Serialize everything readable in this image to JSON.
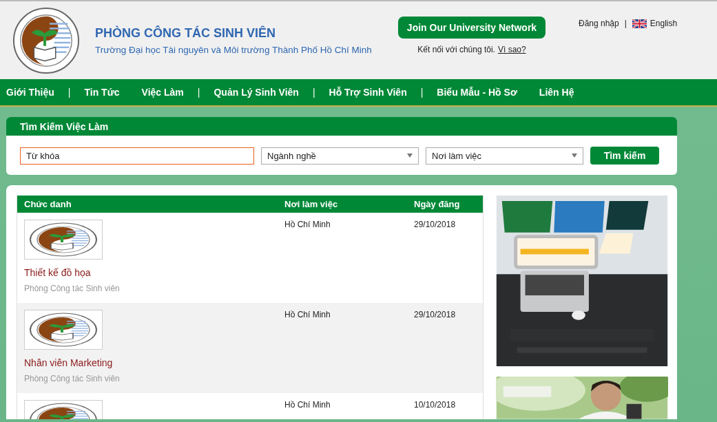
{
  "header": {
    "title": "PHÒNG CÔNG TÁC SINH VIÊN",
    "subtitle": "Trường Đại học Tài nguyên và Môi trường Thành Phố Hồ Chí Minh",
    "join_button": "Join Our University Network",
    "connect_text": "Kết nối với chúng tôi.",
    "why_link": "Vì sao?",
    "login": "Đăng nhập",
    "separator": "|",
    "language": "English"
  },
  "nav": [
    {
      "kind": "link",
      "label": "Giới Thiệu"
    },
    {
      "kind": "separator",
      "label": "|"
    },
    {
      "kind": "link",
      "label": "Tin Tức"
    },
    {
      "kind": "link",
      "label": "Việc Làm"
    },
    {
      "kind": "separator",
      "label": "|"
    },
    {
      "kind": "link",
      "label": "Quản Lý Sinh Viên"
    },
    {
      "kind": "separator",
      "label": "|"
    },
    {
      "kind": "link",
      "label": "Hỗ Trợ Sinh Viên"
    },
    {
      "kind": "separator",
      "label": "|"
    },
    {
      "kind": "link",
      "label": "Biểu Mẫu - Hồ Sơ"
    },
    {
      "kind": "link",
      "label": "Liên Hệ"
    }
  ],
  "search": {
    "title": "Tìm Kiếm Việc Làm",
    "fields": [
      {
        "kind": "text",
        "placeholder": "Từ khóa",
        "focused": true
      },
      {
        "kind": "select",
        "value": "Ngành nghề"
      },
      {
        "kind": "select",
        "value": "Nơi làm việc"
      }
    ],
    "button": "Tìm kiếm"
  },
  "jobs": {
    "columns": [
      "Chức danh",
      "Nơi làm việc",
      "Ngày đăng"
    ],
    "rows": [
      {
        "title": "Thiết kế đồ họa",
        "company": "Phòng Công tác Sinh viên",
        "location": "Hồ Chí Minh",
        "date": "29/10/2018"
      },
      {
        "title": "Nhân viên Marketing",
        "company": "Phòng Công tác Sinh viên",
        "location": "Hồ Chí Minh",
        "date": "29/10/2018"
      },
      {
        "location": "Hồ Chí Minh",
        "date": "10/10/2018"
      }
    ]
  }
}
